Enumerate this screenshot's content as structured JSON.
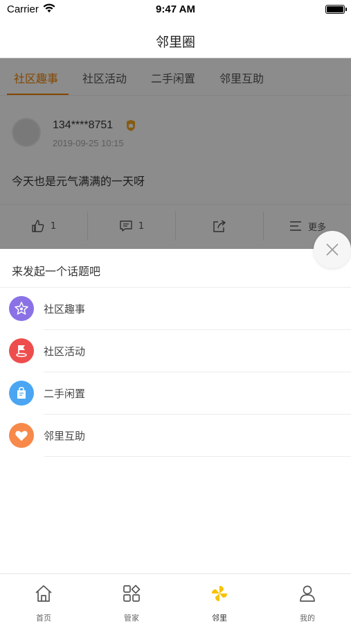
{
  "status_bar": {
    "carrier": "Carrier",
    "time": "9:47 AM"
  },
  "nav": {
    "title": "邻里圈"
  },
  "feed": {
    "tabs": [
      {
        "label": "社区趣事",
        "active": true
      },
      {
        "label": "社区活动",
        "active": false
      },
      {
        "label": "二手闲置",
        "active": false
      },
      {
        "label": "邻里互助",
        "active": false
      }
    ],
    "post": {
      "user": "134****8751",
      "time": "2019-09-25 10:15",
      "text": "今天也是元气满满的一天呀",
      "likes": "1",
      "comments": "1",
      "more_label": "更多"
    }
  },
  "sheet": {
    "title": "来发起一个话题吧",
    "topics": [
      {
        "label": "社区趣事",
        "icon": "star-icon",
        "color": "#8a72e6"
      },
      {
        "label": "社区活动",
        "icon": "flag-icon",
        "color": "#ee4d4d"
      },
      {
        "label": "二手闲置",
        "icon": "bag-icon",
        "color": "#4aa6f3"
      },
      {
        "label": "邻里互助",
        "icon": "heart-icon",
        "color": "#f7894a"
      }
    ]
  },
  "tab_bar": {
    "items": [
      {
        "label": "首页",
        "icon": "home-icon",
        "active": false
      },
      {
        "label": "管家",
        "icon": "grid-icon",
        "active": false
      },
      {
        "label": "邻里",
        "icon": "pinwheel-icon",
        "active": true
      },
      {
        "label": "我的",
        "icon": "person-icon",
        "active": false
      }
    ]
  },
  "colors": {
    "accent": "#f08200",
    "pinwheel": "#f6c300"
  }
}
